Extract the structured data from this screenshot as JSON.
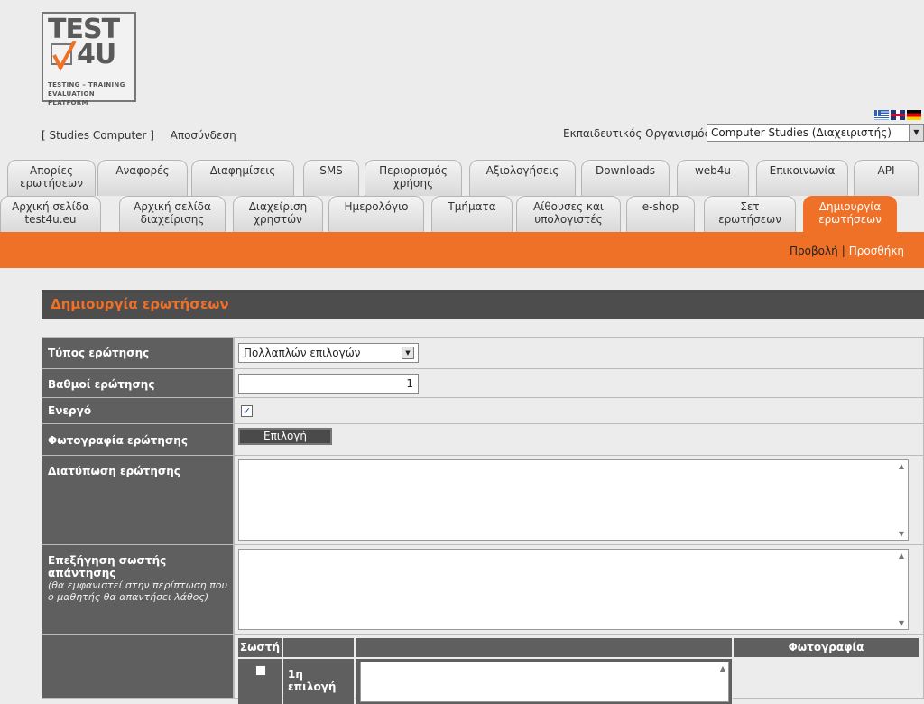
{
  "logo": {
    "line1": "TEST",
    "line2": "4U",
    "tagline1": "TESTING – TRAINING",
    "tagline2": "EVALUATION PLATFORM"
  },
  "top_links": {
    "studies": "[ Studies Computer ]",
    "logout": "Αποσύνδεση"
  },
  "org": {
    "label": "Εκπαιδευτικός Οργανισμός:",
    "value": "Computer Studies (Διαχειριστής)"
  },
  "flags": [
    "greek-flag-icon",
    "english-flag-icon",
    "german-flag-icon"
  ],
  "tabs_row1": [
    {
      "label": "Απορίες\nερωτήσεων"
    },
    {
      "label": "Αναφορές"
    },
    {
      "label": "Διαφημίσεις"
    },
    {
      "label": "SMS"
    },
    {
      "label": "Περιορισμός\nχρήσης"
    },
    {
      "label": "Αξιολογήσεις"
    },
    {
      "label": "Downloads"
    },
    {
      "label": "web4u"
    },
    {
      "label": "Επικοινωνία"
    },
    {
      "label": "API"
    }
  ],
  "tabs_row2": [
    {
      "label": "Αρχική σελίδα\ntest4u.eu"
    },
    {
      "label": "Αρχική σελίδα\nδιαχείρισης"
    },
    {
      "label": "Διαχείριση\nχρηστών"
    },
    {
      "label": "Ημερολόγιο"
    },
    {
      "label": "Τμήματα"
    },
    {
      "label": "Αίθουσες και\nυπολογιστές"
    },
    {
      "label": "e-shop"
    },
    {
      "label": "Σετ\nερωτήσεων"
    },
    {
      "label": "Δημιουργία\nερωτήσεων"
    }
  ],
  "sub_links": {
    "view": "Προβολή",
    "sep": "|",
    "add": "Προσθήκη"
  },
  "section_title": "Δημιουργία ερωτήσεων",
  "form": {
    "type_label": "Τύπος ερώτησης",
    "type_value": "Πολλαπλών επιλογών",
    "grade_label": "Βαθμοί ερώτησης",
    "grade_value": "1",
    "active_label": "Ενεργό",
    "active_checked": true,
    "photo_label": "Φωτογραφία ερώτησης",
    "photo_button": "Επιλογή",
    "wording_label": "Διατύπωση ερώτησης",
    "explain_label": "Επεξήγηση σωστής απάντησης",
    "explain_note": "(θα εμφανιστεί στην περίπτωση που ο μαθητής θα απαντήσει λάθος)",
    "options_header": {
      "correct": "Σωστή",
      "photo": "Φωτογραφία"
    },
    "option1_label": "1η επιλογή"
  }
}
